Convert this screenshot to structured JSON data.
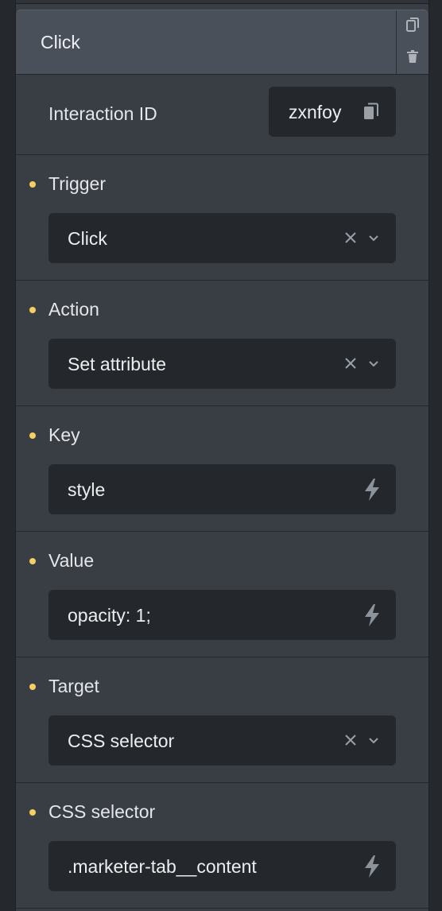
{
  "header": {
    "title": "Click",
    "copy_icon": "copy-icon",
    "delete_icon": "trash-icon"
  },
  "interaction_id": {
    "label": "Interaction ID",
    "value": "zxnfoy",
    "icon": "copy-icon"
  },
  "fields": {
    "trigger": {
      "label": "Trigger",
      "value": "Click"
    },
    "action": {
      "label": "Action",
      "value": "Set attribute"
    },
    "key": {
      "label": "Key",
      "value": "style"
    },
    "value": {
      "label": "Value",
      "value": "opacity: 1;"
    },
    "target": {
      "label": "Target",
      "value": "CSS selector"
    },
    "css_selector": {
      "label": "CSS selector",
      "value": ".marketer-tab__content"
    }
  },
  "colors": {
    "accent_dot": "#f6cf63",
    "panel": "#393d44",
    "input": "#24272c"
  }
}
